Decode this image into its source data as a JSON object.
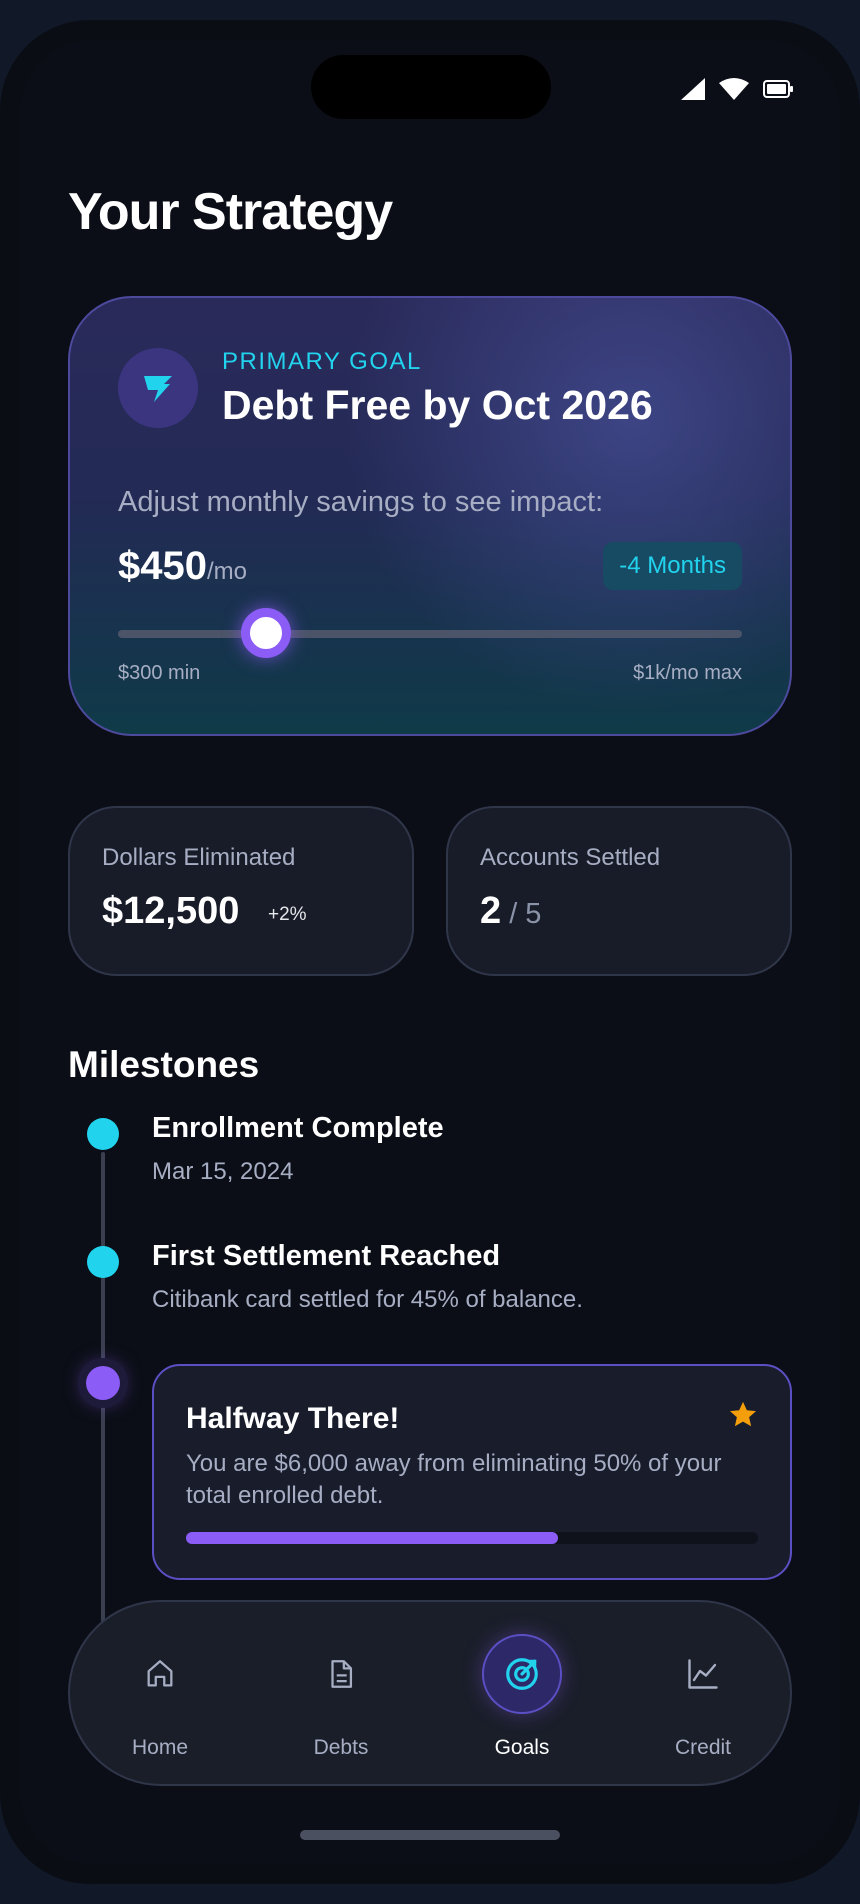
{
  "page": {
    "title": "Your Strategy"
  },
  "status_bar": {
    "icons": [
      "signal-icon",
      "wifi-icon",
      "battery-icon"
    ]
  },
  "goal": {
    "icon": "flag-icon",
    "eyebrow": "PRIMARY GOAL",
    "title": "Debt Free by Oct 2026",
    "hint": "Adjust monthly savings to see impact:",
    "amount": "$450",
    "amount_unit": "/mo",
    "impact": "-4 Months",
    "slider": {
      "min_label": "$300 min",
      "max_label": "$1k/mo max",
      "position_fraction": 0.235
    }
  },
  "stats": {
    "dollars": {
      "label": "Dollars Eliminated",
      "value": "$12,500",
      "delta": "+2%"
    },
    "accounts": {
      "label": "Accounts Settled",
      "value": "2",
      "total": " / 5"
    }
  },
  "milestones": {
    "title": "Milestones",
    "items": [
      {
        "title": "Enrollment Complete",
        "subtitle": "Mar 15, 2024",
        "status": "done"
      },
      {
        "title": "First Settlement Reached",
        "subtitle": "Citibank card settled for 45% of balance.",
        "status": "done"
      }
    ],
    "current": {
      "title": "Halfway There!",
      "text": "You are $6,000 away from eliminating 50% of your total enrolled debt.",
      "icon": "star-icon",
      "progress_fraction": 0.65
    }
  },
  "nav": {
    "items": [
      {
        "label": "Home",
        "icon": "home-icon"
      },
      {
        "label": "Debts",
        "icon": "document-icon"
      },
      {
        "label": "Goals",
        "icon": "target-icon",
        "active": true
      },
      {
        "label": "Credit",
        "icon": "chart-icon"
      }
    ]
  },
  "colors": {
    "accent": "#8b5cf6",
    "cyan": "#22d3ee",
    "star": "#f59e0b",
    "background": "#0b0e16"
  }
}
